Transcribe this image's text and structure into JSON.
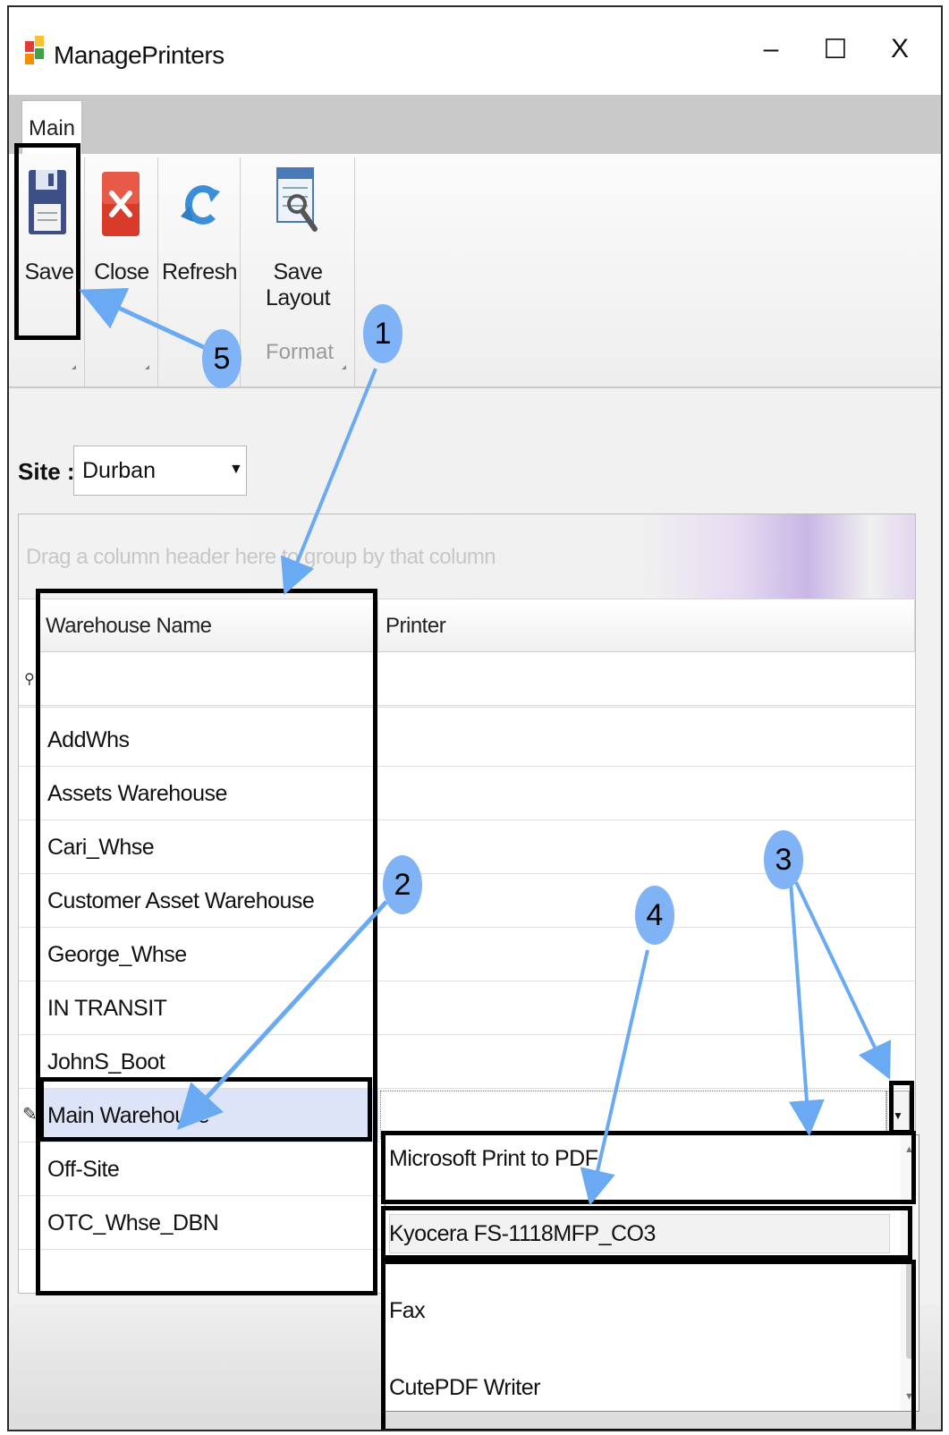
{
  "window": {
    "title": "ManagePrinters",
    "controls": [
      "–",
      "☐",
      "X"
    ]
  },
  "tabs": [
    {
      "label": "Main",
      "active": true
    }
  ],
  "ribbon": {
    "buttons": [
      {
        "label": "Save",
        "icon": "save-floppy-icon"
      },
      {
        "label": "Close",
        "icon": "close-red-x-icon"
      },
      {
        "label": "Refresh",
        "icon": "refresh-arrows-icon"
      },
      {
        "label": "Save Layout",
        "icon": "save-layout-icon"
      }
    ],
    "group_label": "Format"
  },
  "site": {
    "label": "Site :",
    "value": "Durban"
  },
  "grid": {
    "group_panel_hint": "Drag a column header here to group by that column",
    "columns": [
      "Warehouse Name",
      "Printer"
    ],
    "rows": [
      "AddWhs",
      "Assets Warehouse",
      "Cari_Whse",
      "Customer Asset Warehouse",
      "George_Whse",
      "IN TRANSIT",
      "JohnS_Boot",
      "Main Warehouse",
      "Off-Site",
      "OTC_Whse_DBN"
    ],
    "selected_row": "Main Warehouse"
  },
  "printer_dropdown": {
    "options": [
      "Microsoft Print to PDF",
      "Kyocera FS-1118MFP_CO3",
      "Fax",
      "CutePDF Writer"
    ],
    "highlighted": "Kyocera FS-1118MFP_CO3"
  },
  "callouts": [
    "1",
    "2",
    "3",
    "4",
    "5"
  ],
  "colors": {
    "callout": "#7fb3f5",
    "arrow": "#6aaaf2",
    "selected_row": "#dde4f7",
    "highlight_box": "#000000"
  }
}
